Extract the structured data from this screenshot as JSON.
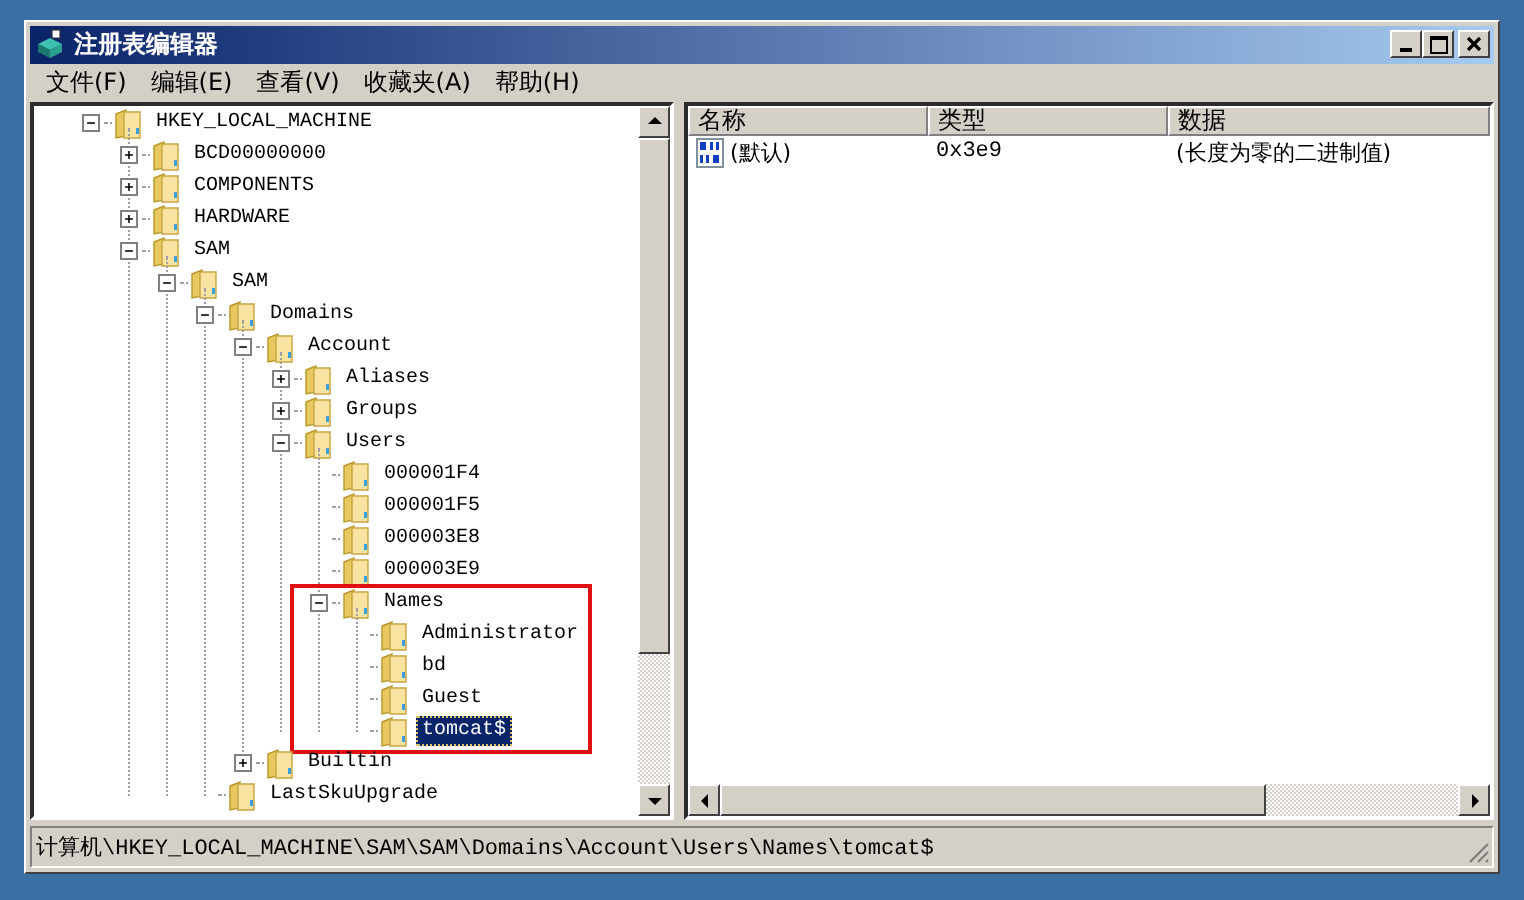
{
  "window": {
    "title": "注册表编辑器"
  },
  "menu": [
    {
      "label": "文件(F)"
    },
    {
      "label": "编辑(E)"
    },
    {
      "label": "查看(V)"
    },
    {
      "label": "收藏夹(A)"
    },
    {
      "label": "帮助(H)"
    }
  ],
  "tree": [
    {
      "label": "HKEY_LOCAL_MACHINE",
      "expanded": true,
      "selected": false,
      "children": [
        {
          "label": "BCD00000000",
          "expanded": false,
          "selected": false
        },
        {
          "label": "COMPONENTS",
          "expanded": false,
          "selected": false
        },
        {
          "label": "HARDWARE",
          "expanded": false,
          "selected": false
        },
        {
          "label": "SAM",
          "expanded": true,
          "selected": false,
          "children": [
            {
              "label": "SAM",
              "expanded": true,
              "selected": false,
              "children": [
                {
                  "label": "Domains",
                  "expanded": true,
                  "selected": false,
                  "children": [
                    {
                      "label": "Account",
                      "expanded": true,
                      "selected": false,
                      "children": [
                        {
                          "label": "Aliases",
                          "expanded": false,
                          "selected": false
                        },
                        {
                          "label": "Groups",
                          "expanded": false,
                          "selected": false
                        },
                        {
                          "label": "Users",
                          "expanded": true,
                          "selected": false,
                          "children": [
                            {
                              "label": "000001F4",
                              "selected": false
                            },
                            {
                              "label": "000001F5",
                              "selected": false
                            },
                            {
                              "label": "000003E8",
                              "selected": false
                            },
                            {
                              "label": "000003E9",
                              "selected": false
                            },
                            {
                              "label": "Names",
                              "expanded": true,
                              "selected": false,
                              "highlighted": true,
                              "children": [
                                {
                                  "label": "Administrator",
                                  "selected": false
                                },
                                {
                                  "label": "bd",
                                  "selected": false
                                },
                                {
                                  "label": "Guest",
                                  "selected": false
                                },
                                {
                                  "label": "tomcat$",
                                  "selected": true
                                }
                              ]
                            }
                          ]
                        }
                      ]
                    },
                    {
                      "label": "Builtin",
                      "expanded": false,
                      "selected": false
                    }
                  ]
                },
                {
                  "label": "LastSkuUpgrade",
                  "selected": false
                }
              ]
            }
          ]
        }
      ]
    }
  ],
  "list": {
    "columns": [
      "名称",
      "类型",
      "数据"
    ],
    "rows": [
      {
        "name": "(默认)",
        "type": "0x3e9",
        "data": "(长度为零的二进制值)"
      }
    ]
  },
  "status_bar": "计算机\\HKEY_LOCAL_MACHINE\\SAM\\SAM\\Domains\\Account\\Users\\Names\\tomcat$"
}
